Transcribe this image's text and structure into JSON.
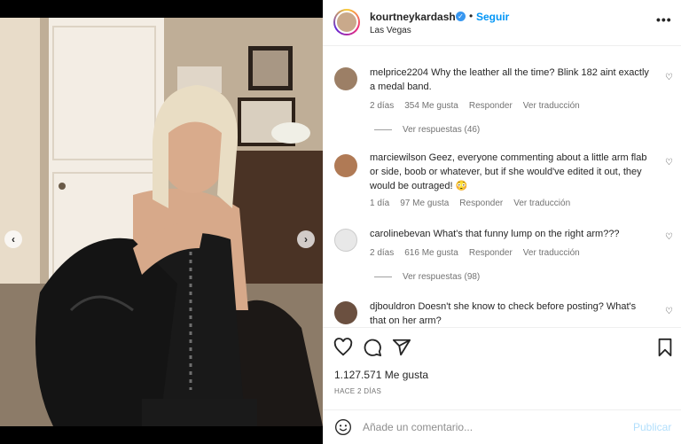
{
  "post": {
    "username": "kourtneykardash",
    "follow_label": "Seguir",
    "bullet": "•",
    "location": "Las Vegas",
    "more_label": "•••"
  },
  "carousel": {
    "prev_symbol": "‹",
    "next_symbol": "›",
    "slide_count": 3,
    "active_slide": 1
  },
  "comments": [
    {
      "user": "melprice2204",
      "text": "Why the leather all the time? Blink 182 aint exactly a medal band.",
      "time": "2 días",
      "likes": "354 Me gusta",
      "reply": "Responder",
      "translate": "Ver traducción",
      "view_replies": "Ver respuestas (46)"
    },
    {
      "user": "marciewilson",
      "text": "Geez, everyone commenting about a little arm flab or side, boob or whatever, but if she would've edited it out, they would be outraged! 😳",
      "time": "1 día",
      "likes": "97 Me gusta",
      "reply": "Responder",
      "translate": "Ver traducción"
    },
    {
      "user": "carolinebevan",
      "text": "What's that funny lump on the right arm???",
      "time": "2 días",
      "likes": "616 Me gusta",
      "reply": "Responder",
      "translate": "Ver traducción",
      "view_replies": "Ver respuestas (98)"
    },
    {
      "user": "djbouldron",
      "text": "Doesn't she know to check before posting? What's that on her arm?"
    }
  ],
  "stats": {
    "likes": "1.127.571 Me gusta",
    "time_ago": "HACE 2 DÍAS"
  },
  "composer": {
    "placeholder": "Añade un comentario...",
    "publish_label": "Publicar"
  },
  "icons": {
    "heart": "heart-icon",
    "comment": "comment-icon",
    "share": "share-icon",
    "save": "bookmark-icon",
    "emoji": "emoji-icon",
    "verified": "verified-badge-icon"
  },
  "colors": {
    "accent": "#0095f6",
    "publish_disabled": "#b2dffc",
    "verified": "#3897f0",
    "meta_text": "#737373"
  }
}
